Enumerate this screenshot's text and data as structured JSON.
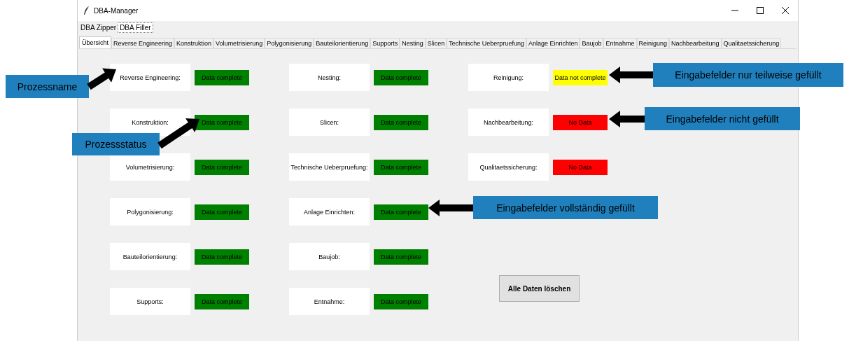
{
  "window": {
    "title": "DBA-Manager"
  },
  "app_tabs": [
    {
      "label": "DBA Zipper",
      "selected": false
    },
    {
      "label": "DBA Filler",
      "selected": true
    }
  ],
  "process_tabs": [
    {
      "label": "Übersicht",
      "selected": true
    },
    {
      "label": "Reverse Engineering",
      "selected": false
    },
    {
      "label": "Konstruktion",
      "selected": false
    },
    {
      "label": "Volumetrisierung",
      "selected": false
    },
    {
      "label": "Polygonisierung",
      "selected": false
    },
    {
      "label": "Bauteilorientierung",
      "selected": false
    },
    {
      "label": "Supports",
      "selected": false
    },
    {
      "label": "Nesting",
      "selected": false
    },
    {
      "label": "Slicen",
      "selected": false
    },
    {
      "label": "Technische Ueberpruefung",
      "selected": false
    },
    {
      "label": "Anlage Einrichten",
      "selected": false
    },
    {
      "label": "Baujob",
      "selected": false
    },
    {
      "label": "Entnahme",
      "selected": false
    },
    {
      "label": "Reinigung",
      "selected": false
    },
    {
      "label": "Nachbearbeitung",
      "selected": false
    },
    {
      "label": "Qualitaetssicherung",
      "selected": false
    }
  ],
  "processes": [
    {
      "name": "Reverse Engineering:",
      "status": {
        "kind": "complete",
        "text": "Data complete"
      }
    },
    {
      "name": "Konstruktion:",
      "status": {
        "kind": "complete",
        "text": "Data complete"
      }
    },
    {
      "name": "Volumetrisierung:",
      "status": {
        "kind": "complete",
        "text": "Data complete"
      }
    },
    {
      "name": "Polygonisierung:",
      "status": {
        "kind": "complete",
        "text": "Data complete"
      }
    },
    {
      "name": "Bauteilorientierung:",
      "status": {
        "kind": "complete",
        "text": "Data complete"
      }
    },
    {
      "name": "Supports:",
      "status": {
        "kind": "complete",
        "text": "Data complete"
      }
    },
    {
      "name": "Nesting:",
      "status": {
        "kind": "complete",
        "text": "Data complete"
      }
    },
    {
      "name": "Slicen:",
      "status": {
        "kind": "complete",
        "text": "Data complete"
      }
    },
    {
      "name": "Technische Ueberpruefung:",
      "status": {
        "kind": "complete",
        "text": "Data complete"
      }
    },
    {
      "name": "Anlage Einrichten:",
      "status": {
        "kind": "complete",
        "text": "Data complete"
      }
    },
    {
      "name": "Baujob:",
      "status": {
        "kind": "complete",
        "text": "Data complete"
      }
    },
    {
      "name": "Entnahme:",
      "status": {
        "kind": "complete",
        "text": "Data complete"
      }
    },
    {
      "name": "Reinigung:",
      "status": {
        "kind": "partial",
        "text": "Data not complete"
      }
    },
    {
      "name": "Nachbearbeitung:",
      "status": {
        "kind": "none",
        "text": "No Data"
      }
    },
    {
      "name": "Qualitaetssicherung:",
      "status": {
        "kind": "none",
        "text": "No Data"
      }
    }
  ],
  "delete_button": {
    "label": "Alle Daten löschen"
  },
  "callouts": [
    {
      "text": "Prozessname"
    },
    {
      "text": "Prozessstatus"
    },
    {
      "text": "Eingabefelder  nur teilweise gefüllt"
    },
    {
      "text": "Eingabefelder  nicht gefüllt"
    },
    {
      "text": "Eingabefelder  vollständig gefüllt"
    }
  ]
}
